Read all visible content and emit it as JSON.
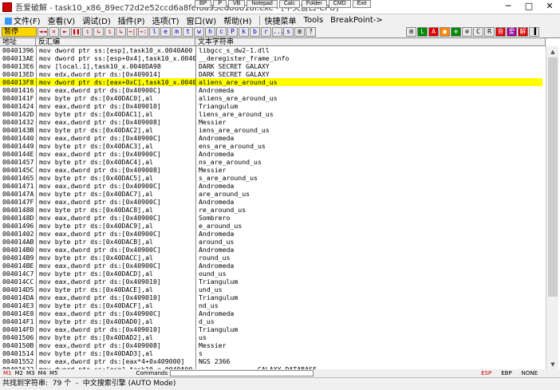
{
  "window": {
    "title": "吾爱破解 - task10_x86_89ec72d2e52ccd6a8fef8a95ed86818f.exe - [中央窗口-CPU]",
    "controls": [
      "─",
      "□",
      "✕"
    ]
  },
  "plugin_buttons": [
    "BP",
    "P",
    "VB",
    "Notepad",
    "Calc",
    "Folder",
    "CMD",
    "Exit"
  ],
  "menu": {
    "items": [
      "文件(F)",
      "查看(V)",
      "调试(D)",
      "插件(P)",
      "选项(T)",
      "窗口(W)",
      "帮助(H)",
      "快捷菜单",
      "Tools",
      "BreakPoint->"
    ]
  },
  "toolbar": {
    "status": "暂停",
    "buttons": [
      "◄◄",
      "✕",
      "►",
      "❚❚",
      "↴",
      "↳",
      "↴",
      "↳",
      "→|",
      "→:",
      "l",
      "e",
      "m",
      "t",
      "w",
      "h",
      "c",
      "P",
      "k",
      "b",
      "r",
      "...",
      "s",
      "⊞",
      "?"
    ],
    "right_buttons": [
      "⊞",
      "L",
      "A",
      "●",
      "⊕",
      "⊗",
      "C",
      "R",
      "音",
      "爱",
      "解",
      "▐"
    ]
  },
  "columns": {
    "addr": "地址",
    "asm": "反汇编",
    "str": "文本字符串"
  },
  "rows": [
    {
      "addr": "00401396",
      "asm": "mov dword ptr ss:[esp],task10_x.0040A00",
      "str": "libgcc_s_dw2-1.dll"
    },
    {
      "addr": "004013AE",
      "asm": "mov dword ptr ss:[esp+0x4],task10_x.0040",
      "str": "__deregister_frame_info"
    },
    {
      "addr": "004013E6",
      "asm": "mov [local.1],task10_x.0040DA98",
      "str": "DARK SECRET GALAXY"
    },
    {
      "addr": "004013ED",
      "asm": "mov edx,dword ptr ds:[0x409014]",
      "str": "DARK SECRET GALAXY"
    },
    {
      "addr": "004013F8",
      "asm": "mov dword ptr ds:[eax+0xC],task10_x.0040",
      "str": "aliens_are_around_us",
      "sel": true
    },
    {
      "addr": "00401416",
      "asm": "mov eax,dword ptr ds:[0x40900C]",
      "str": "Andromeda"
    },
    {
      "addr": "0040141F",
      "asm": "mov byte ptr ds:[0x40DAC0],al",
      "str": "aliens_are_around_us"
    },
    {
      "addr": "00401424",
      "asm": "mov eax,dword ptr ds:[0x409010]",
      "str": "Triangulum"
    },
    {
      "addr": "0040142D",
      "asm": "mov byte ptr ds:[0x40DAC1],al",
      "str": "liens_are_around_us"
    },
    {
      "addr": "00401432",
      "asm": "mov eax,dword ptr ds:[0x409008]",
      "str": "Messier"
    },
    {
      "addr": "0040143B",
      "asm": "mov byte ptr ds:[0x40DAC2],al",
      "str": "iens_are_around_us"
    },
    {
      "addr": "00401440",
      "asm": "mov eax,dword ptr ds:[0x40900C]",
      "str": "Andromeda"
    },
    {
      "addr": "00401449",
      "asm": "mov byte ptr ds:[0x40DAC3],al",
      "str": "ens_are_around_us"
    },
    {
      "addr": "0040144E",
      "asm": "mov eax,dword ptr ds:[0x40900C]",
      "str": "Andromeda"
    },
    {
      "addr": "00401457",
      "asm": "mov byte ptr ds:[0x40DAC4],al",
      "str": "ns_are_around_us"
    },
    {
      "addr": "0040145C",
      "asm": "mov eax,dword ptr ds:[0x409008]",
      "str": "Messier"
    },
    {
      "addr": "00401465",
      "asm": "mov byte ptr ds:[0x40DAC5],al",
      "str": "s_are_around_us"
    },
    {
      "addr": "00401471",
      "asm": "mov eax,dword ptr ds:[0x40900C]",
      "str": "Andromeda"
    },
    {
      "addr": "0040147A",
      "asm": "mov byte ptr ds:[0x40DAC7],al",
      "str": "are_around_us"
    },
    {
      "addr": "0040147F",
      "asm": "mov eax,dword ptr ds:[0x40900C]",
      "str": "Andromeda"
    },
    {
      "addr": "00401488",
      "asm": "mov byte ptr ds:[0x40DAC8],al",
      "str": "re_around_us"
    },
    {
      "addr": "0040148D",
      "asm": "mov eax,dword ptr ds:[0x40900C]",
      "str": "Sombrero"
    },
    {
      "addr": "00401496",
      "asm": "mov byte ptr ds:[0x40DAC9],al",
      "str": "e_around_us"
    },
    {
      "addr": "00401402",
      "asm": "mov eax,dword ptr ds:[0x40900C]",
      "str": "Andromeda"
    },
    {
      "addr": "004014AB",
      "asm": "mov byte ptr ds:[0x40DACB],al",
      "str": "around_us"
    },
    {
      "addr": "004014B0",
      "asm": "mov eax,dword ptr ds:[0x40900C]",
      "str": "Andromeda"
    },
    {
      "addr": "004014B9",
      "asm": "mov byte ptr ds:[0x40DACC],al",
      "str": "round_us"
    },
    {
      "addr": "004014BE",
      "asm": "mov eax,dword ptr ds:[0x40900C]",
      "str": "Andromeda"
    },
    {
      "addr": "004014C7",
      "asm": "mov byte ptr ds:[0x40DACD],al",
      "str": "ound_us"
    },
    {
      "addr": "004014CC",
      "asm": "mov eax,dword ptr ds:[0x409010]",
      "str": "Triangulum"
    },
    {
      "addr": "004014D5",
      "asm": "mov byte ptr ds:[0x40DACE],al",
      "str": "und_us"
    },
    {
      "addr": "004014DA",
      "asm": "mov eax,dword ptr ds:[0x409010]",
      "str": "Triangulum"
    },
    {
      "addr": "004014E3",
      "asm": "mov byte ptr ds:[0x40DACF],al",
      "str": "nd_us"
    },
    {
      "addr": "004014E8",
      "asm": "mov eax,dword ptr ds:[0x40900C]",
      "str": "Andromeda"
    },
    {
      "addr": "004014F1",
      "asm": "mov byte ptr ds:[0x40DAD0],al",
      "str": "d_us"
    },
    {
      "addr": "004014FD",
      "asm": "mov eax,dword ptr ds:[0x409010]",
      "str": "Triangulum"
    },
    {
      "addr": "00401506",
      "asm": "mov byte ptr ds:[0x40DAD2],al",
      "str": "us"
    },
    {
      "addr": "0040150B",
      "asm": "mov eax,dword ptr ds:[0x409008]",
      "str": "Messier"
    },
    {
      "addr": "00401514",
      "asm": "mov byte ptr ds:[0x40DAD3],al",
      "str": "s"
    },
    {
      "addr": "00401552",
      "asm": "mov eax,dword ptr ds:[eax*4+0x409000]",
      "str": "NGS 2366"
    },
    {
      "addr": "00401622",
      "asm": "mov dword ptr ss:[esp],task10_x.0040A00",
      "str": "---------------GALAXY DATABASE-----------"
    }
  ],
  "tabs": {
    "items": [
      "M1",
      "M2",
      "M3",
      "M4",
      "M5"
    ],
    "commands_label": "Commands",
    "registers": [
      "ESP",
      "EBP",
      "NONE"
    ]
  },
  "status": {
    "text": "共找到字符串:  79 个  -  中文搜索引擎 (AUTO Mode)"
  }
}
